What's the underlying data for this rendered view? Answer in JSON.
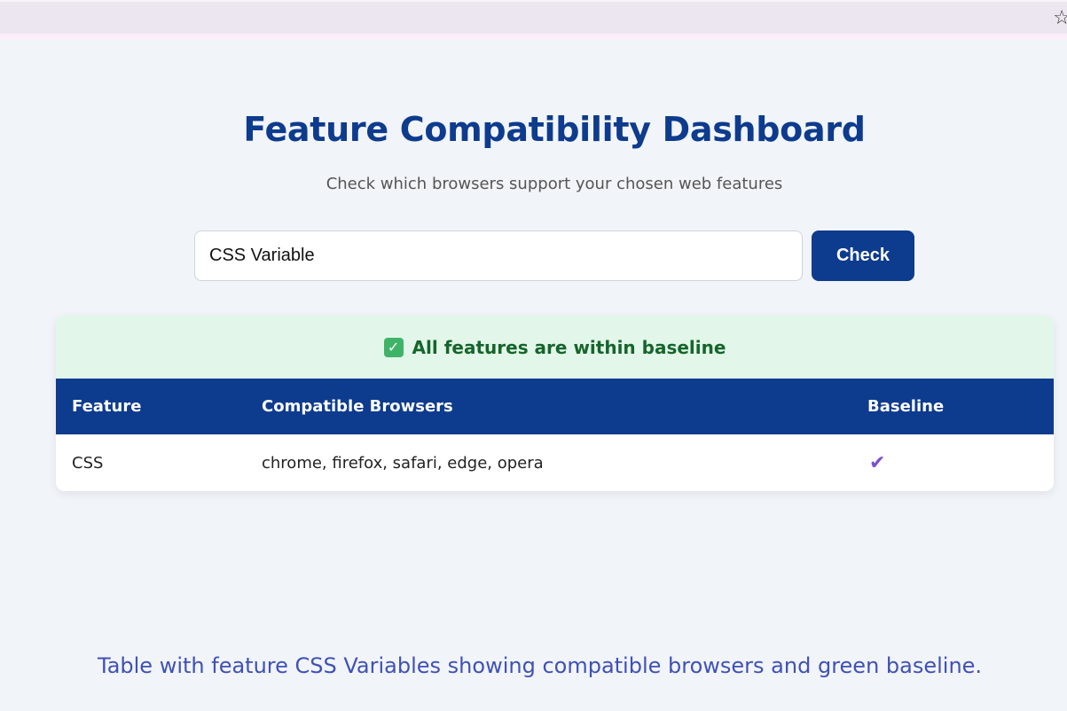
{
  "browser_bar": {
    "star_icon": "star-outline-icon"
  },
  "header": {
    "title": "Feature Compatibility Dashboard",
    "subtitle": "Check which browsers support your chosen web features"
  },
  "search": {
    "value": "CSS Variable",
    "button_label": "Check"
  },
  "result": {
    "banner_icon": "checkbox-check-icon",
    "banner_text": "All features are within baseline",
    "banner_color": "#e2f7e9",
    "columns": [
      "Feature",
      "Compatible Browsers",
      "Baseline"
    ],
    "rows": [
      {
        "feature": "CSS",
        "browsers": "chrome, firefox, safari, edge, opera",
        "baseline_icon": "checkmark-icon",
        "baseline": "✔"
      }
    ]
  },
  "caption": "Table with feature CSS Variables showing compatible browsers and green baseline.",
  "colors": {
    "accent": "#0d3b8e",
    "success": "#16652c",
    "baseline_check": "#7b4fd1",
    "caption": "#3f51b5"
  }
}
